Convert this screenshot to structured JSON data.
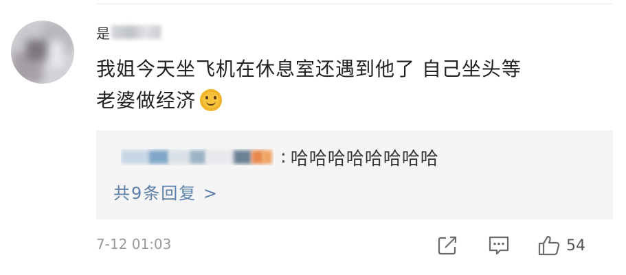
{
  "comment": {
    "username_visible": "是",
    "text_line1": "我姐今天坐飞机在休息室还遇到他了 自己坐头等",
    "text_line2": "老婆做经济",
    "emoji_icon": "smile-emoji-icon"
  },
  "reply": {
    "separator": ":",
    "text": "哈哈哈哈哈哈哈哈",
    "count_label": "共9条回复 >"
  },
  "footer": {
    "timestamp": "7-12 01:03",
    "share_icon": "share-icon",
    "comment_icon": "comment-icon",
    "like_icon": "thumbs-up-icon",
    "like_count": "54"
  },
  "colors": {
    "link": "#5a7fa8",
    "reply_bg": "#f5f5f5",
    "meta": "#999999"
  }
}
